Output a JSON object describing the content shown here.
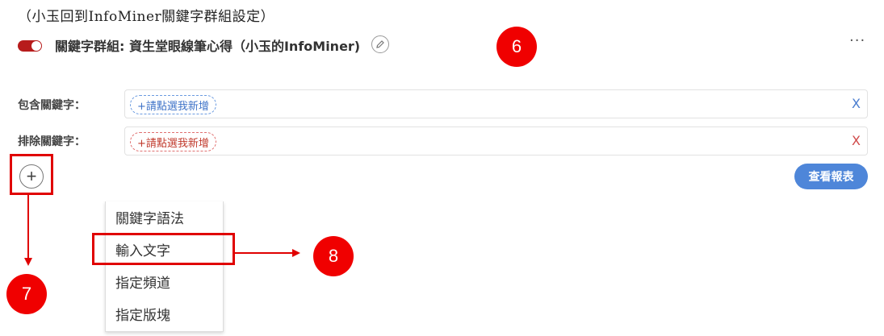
{
  "caption": "（小玉回到InfoMiner關鍵字群組設定）",
  "group": {
    "title": "關鍵字群組: 資生堂眼線筆心得（小玉的InfoMiner)",
    "more_label": "···"
  },
  "include_row": {
    "label": "包含關鍵字：",
    "chip_label": "+請點選我新增",
    "clear_label": "X"
  },
  "exclude_row": {
    "label": "排除關鍵字：",
    "chip_label": "+請點選我新增",
    "clear_label": "X"
  },
  "add_button_label": "+",
  "report_button_label": "查看報表",
  "menu": {
    "items": [
      "關鍵字語法",
      "輸入文字",
      "指定頻道",
      "指定版塊"
    ]
  },
  "annotations": {
    "badge_6": "6",
    "badge_7": "7",
    "badge_8": "8"
  },
  "colors": {
    "toggle_on": "#b71c1c",
    "annotation_red": "#f00000",
    "primary_blue": "#4e86d9"
  }
}
